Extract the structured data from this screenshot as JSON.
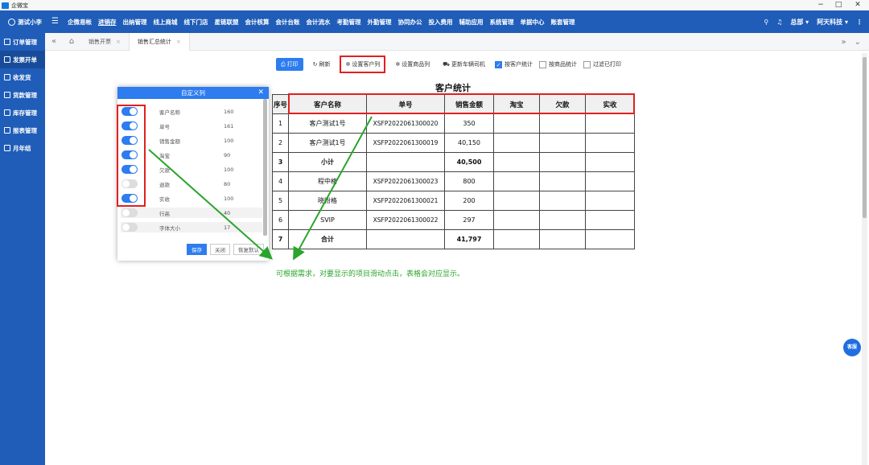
{
  "window": {
    "title": "企微宝",
    "min": "−",
    "max": "□",
    "close": "✕"
  },
  "navbar": {
    "user": "测试小李",
    "items": [
      "企微易帐",
      "进销存",
      "出纳管理",
      "线上商城",
      "线下门店",
      "星链联盟",
      "会计核算",
      "会计台账",
      "会计流水",
      "考勤管理",
      "外勤管理",
      "协同办公",
      "投入费用",
      "辅助应用",
      "系统管理",
      "单据中心",
      "账套管理"
    ],
    "active_index": 1,
    "right": {
      "dept": "总部 ▾",
      "company": "阿天科技 ▾",
      "more": "⋮"
    }
  },
  "sidebar": {
    "items": [
      "订单管理",
      "发票开单",
      "收发货",
      "货款管理",
      "库存管理",
      "报表管理",
      "月年结"
    ],
    "active_index": 1
  },
  "tabs": {
    "items": [
      {
        "label": "销售开票"
      },
      {
        "label": "销售汇总统计"
      }
    ],
    "active_index": 1
  },
  "toolbar": {
    "print": "打印",
    "refresh": "刷新",
    "set_customer_cols": "设置客户列",
    "set_product_cols": "设置商品列",
    "update_driver": "更新车辆司机",
    "cb_by_customer": "按客户统计",
    "cb_by_product": "按商品统计",
    "cb_filter_printed": "过滤已打印"
  },
  "modal": {
    "title": "自定义列",
    "rows": [
      {
        "name": "客户名称",
        "width": "160",
        "on": true
      },
      {
        "name": "单号",
        "width": "161",
        "on": true
      },
      {
        "name": "销售金额",
        "width": "100",
        "on": true
      },
      {
        "name": "淘宝",
        "width": "90",
        "on": true
      },
      {
        "name": "欠款",
        "width": "100",
        "on": true
      },
      {
        "name": "退款",
        "width": "80",
        "on": false
      },
      {
        "name": "实收",
        "width": "100",
        "on": true
      },
      {
        "name": "行高",
        "width": "40",
        "on": false
      },
      {
        "name": "字体大小",
        "width": "17",
        "on": false
      }
    ],
    "save": "保存",
    "close": "关闭",
    "reset": "恢复默认"
  },
  "report": {
    "title": "客户统计",
    "headers": [
      "序号",
      "客户名称",
      "单号",
      "销售金额",
      "淘宝",
      "欠款",
      "实收"
    ],
    "rows": [
      {
        "no": "1",
        "customer": "客户测试1号",
        "order": "XSFP2022061300020",
        "amount": "350",
        "taobao": "",
        "debt": "",
        "received": "",
        "bold": false
      },
      {
        "no": "2",
        "customer": "客户测试1号",
        "order": "XSFP2022061300019",
        "amount": "40,150",
        "taobao": "",
        "debt": "",
        "received": "",
        "bold": false
      },
      {
        "no": "3",
        "customer": "小计",
        "order": "",
        "amount": "40,500",
        "taobao": "",
        "debt": "",
        "received": "",
        "bold": true
      },
      {
        "no": "4",
        "customer": "程中格",
        "order": "XSFP2022061300023",
        "amount": "800",
        "taobao": "",
        "debt": "",
        "received": "",
        "bold": false
      },
      {
        "no": "5",
        "customer": "晓粉格",
        "order": "XSFP2022061300021",
        "amount": "200",
        "taobao": "",
        "debt": "",
        "received": "",
        "bold": false
      },
      {
        "no": "6",
        "customer": "SVIP",
        "order": "XSFP2022061300022",
        "amount": "297",
        "taobao": "",
        "debt": "",
        "received": "",
        "bold": false
      },
      {
        "no": "7",
        "customer": "合计",
        "order": "",
        "amount": "41,797",
        "taobao": "",
        "debt": "",
        "received": "",
        "bold": true
      }
    ]
  },
  "annotation": "可根据需求，对要显示的项目滑动点击，表格会对应显示。",
  "kefu": "客服",
  "colors": {
    "brand": "#1f5db8",
    "accent": "#2d7cf0",
    "highlight": "#e02020",
    "annotation": "#2aa52a"
  }
}
